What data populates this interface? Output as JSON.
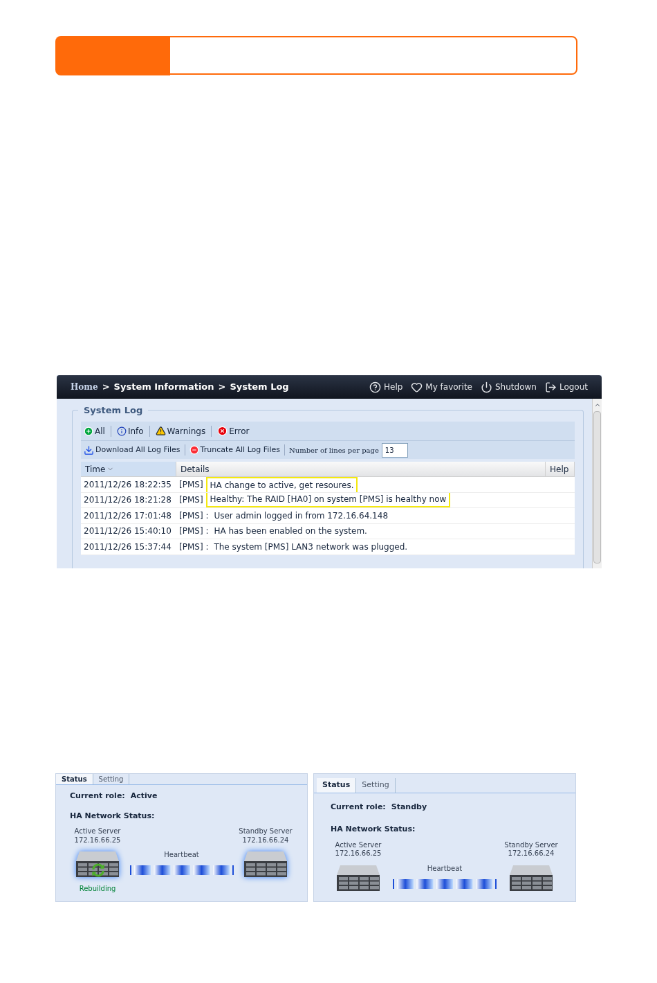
{
  "log_window": {
    "breadcrumb": [
      {
        "label": "Home",
        "kind": "link"
      },
      {
        "label": "System Information",
        "kind": "page"
      },
      {
        "label": "System Log",
        "kind": "page"
      }
    ],
    "separator": ">",
    "toolbar": [
      {
        "label": "Help"
      },
      {
        "label": "My favorite"
      },
      {
        "label": "Shutdown"
      },
      {
        "label": "Logout"
      }
    ],
    "section_title": "System Log",
    "filters": [
      {
        "label": "All"
      },
      {
        "label": "Info"
      },
      {
        "label": "Warnings"
      },
      {
        "label": "Error"
      }
    ],
    "actions": [
      {
        "label": "Download All Log Files"
      },
      {
        "label": "Truncate All Log Files"
      }
    ],
    "lines_per_page": {
      "label": "Number of lines per page",
      "value": "13"
    },
    "table": {
      "columns": [
        {
          "label": "Time",
          "sorted": true
        },
        {
          "label": "Details",
          "sorted": false
        },
        {
          "label": "Help",
          "sorted": false
        }
      ],
      "rows": [
        {
          "time": "2011/12/26 18:22:35",
          "source": "[PMS]",
          "message": "HA change to active, get resoures.",
          "highlighted": true
        },
        {
          "time": "2011/12/26 18:21:28",
          "source": "[PMS]",
          "message": "Healthy: The RAID [HA0] on system [PMS] is healthy now",
          "highlighted": true
        },
        {
          "time": "2011/12/26 17:01:48",
          "source": "[PMS] :",
          "message": "User admin logged in from 172.16.64.148",
          "highlighted": false
        },
        {
          "time": "2011/12/26 15:40:10",
          "source": "[PMS] :",
          "message": "HA has been enabled on the system.",
          "highlighted": false
        },
        {
          "time": "2011/12/26 15:37:44",
          "source": "[PMS] :",
          "message": "The system [PMS] LAN3 network was plugged.",
          "highlighted": false
        }
      ]
    }
  },
  "ha_panels": [
    {
      "tabs": [
        {
          "label": "Status",
          "selected": true
        },
        {
          "label": "Setting",
          "selected": false
        }
      ],
      "role_label": "Current role:",
      "role": "Active",
      "network_label": "HA Network Status:",
      "heartbeat": "Heartbeat",
      "servers": [
        {
          "name": "Active Server",
          "ip": "172.16.66.25",
          "glowing": true,
          "status": "Rebuilding"
        },
        {
          "name": "Standby Server",
          "ip": "172.16.66.24",
          "glowing": true
        }
      ]
    },
    {
      "tabs": [
        {
          "label": "Status",
          "selected": true
        },
        {
          "label": "Setting",
          "selected": false
        }
      ],
      "role_label": "Current role:",
      "role": "Standby",
      "network_label": "HA Network Status:",
      "heartbeat": "Heartbeat",
      "servers": [
        {
          "name": "Active Server",
          "ip": "172.16.66.25",
          "glowing": false
        },
        {
          "name": "Standby Server",
          "ip": "172.16.66.24",
          "glowing": false
        }
      ]
    }
  ]
}
